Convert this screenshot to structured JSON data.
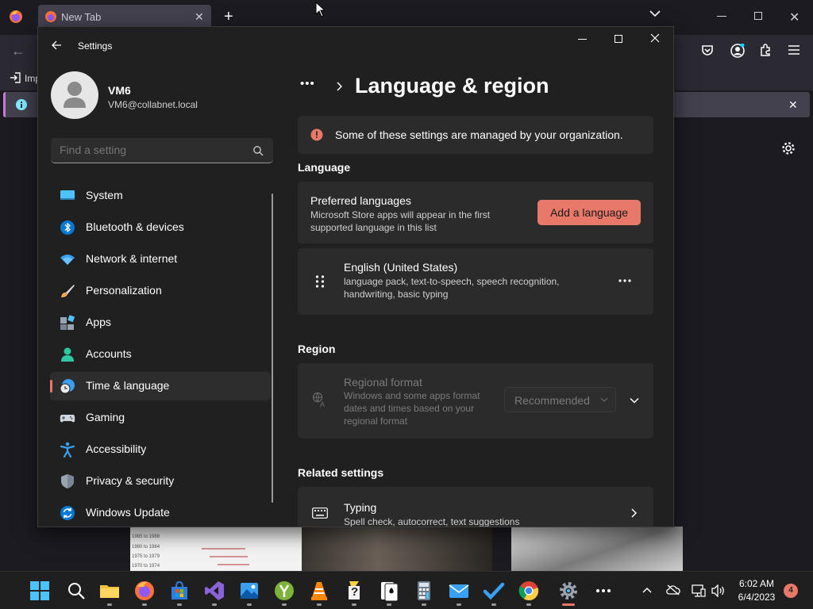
{
  "firefox": {
    "tab_title": "New Tab",
    "bookmark_import_label": "Imp",
    "info_bar_icon": "info-icon"
  },
  "settings": {
    "window_title": "Settings",
    "user": {
      "name": "VM6",
      "email": "VM6@collabnet.local"
    },
    "search": {
      "placeholder": "Find a setting"
    },
    "nav_items": [
      {
        "label": "System",
        "icon": "system-icon"
      },
      {
        "label": "Bluetooth & devices",
        "icon": "bluetooth-icon"
      },
      {
        "label": "Network & internet",
        "icon": "wifi-icon"
      },
      {
        "label": "Personalization",
        "icon": "brush-icon"
      },
      {
        "label": "Apps",
        "icon": "apps-icon"
      },
      {
        "label": "Accounts",
        "icon": "person-icon"
      },
      {
        "label": "Time & language",
        "icon": "clock-globe-icon",
        "active": true
      },
      {
        "label": "Gaming",
        "icon": "gamepad-icon"
      },
      {
        "label": "Accessibility",
        "icon": "accessibility-icon"
      },
      {
        "label": "Privacy & security",
        "icon": "shield-icon"
      },
      {
        "label": "Windows Update",
        "icon": "update-icon"
      }
    ],
    "breadcrumb_ellipsis": "•••",
    "page_title": "Language & region",
    "org_notice": "Some of these settings are managed by your organization.",
    "language_section": "Language",
    "preferred_languages": {
      "title": "Preferred languages",
      "description": "Microsoft Store apps will appear in the first supported language in this list",
      "add_button": "Add a language"
    },
    "language_entry": {
      "name": "English (United States)",
      "details": "language pack, text-to-speech, speech recognition, handwriting, basic typing"
    },
    "region_section": "Region",
    "regional_format": {
      "title": "Regional format",
      "description": "Windows and some apps format dates and times based on your regional format",
      "selected_value": "Recommended"
    },
    "related_section": "Related settings",
    "typing": {
      "title": "Typing",
      "description": "Spell check, autocorrect, text suggestions"
    }
  },
  "taskbar": {
    "time": "6:02 AM",
    "date": "6/4/2023",
    "notification_count": "4"
  },
  "colors": {
    "accent": "#e8786a",
    "window_bg": "#202020",
    "card_bg": "#2b2b2b",
    "warning_icon": "#e8786a"
  }
}
